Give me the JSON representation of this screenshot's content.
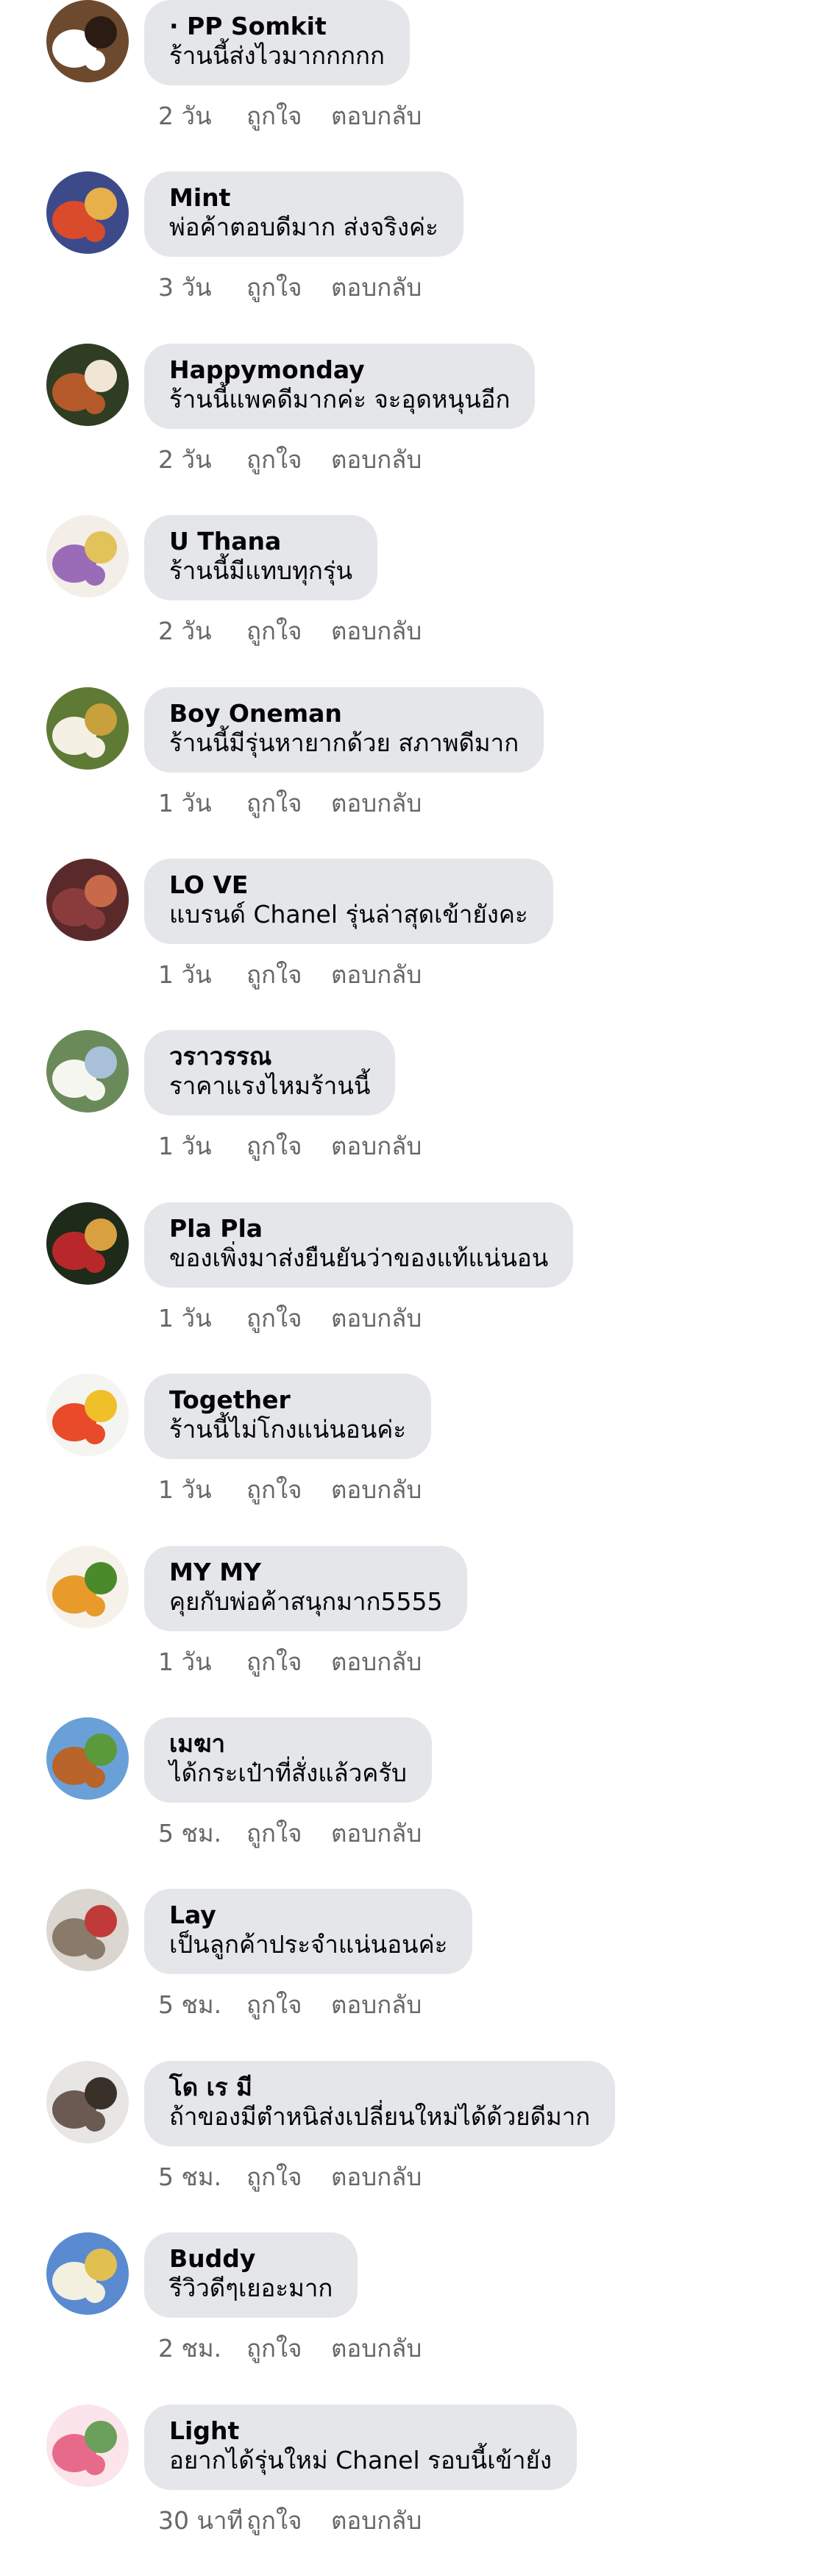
{
  "comments": [
    {
      "author": "· PP Somkit",
      "text": "ร้านนี้ส่งไวมากกกกก",
      "time": "2 วัน",
      "like": "ถูกใจ",
      "reply": "ตอบกลับ",
      "avatar_icon": "beagle-dog-avatar",
      "colors": [
        "#6d4a2e",
        "#ffffff",
        "#2a1c12"
      ]
    },
    {
      "author": "Mint",
      "text": "พ่อค้าตอบดีมาก ส่งจริงค่ะ",
      "time": "3 วัน",
      "like": "ถูกใจ",
      "reply": "ตอบกลับ",
      "avatar_icon": "fruit-bowl-avatar",
      "colors": [
        "#3d4a8a",
        "#d94b2b",
        "#e8b04a"
      ]
    },
    {
      "author": "Happymonday",
      "text": "ร้านนี้แพคดีมากค่ะ จะอุดหนุนอีก",
      "time": "2 วัน",
      "like": "ถูกใจ",
      "reply": "ตอบกลับ",
      "avatar_icon": "red-panda-avatar",
      "colors": [
        "#2f3d22",
        "#b45a2a",
        "#f1e6d6"
      ]
    },
    {
      "author": "U Thana",
      "text": "ร้านนี้มีแทบทุกรุ่น",
      "time": "2 วัน",
      "like": "ถูกใจ",
      "reply": "ตอบกลับ",
      "avatar_icon": "flower-bouquet-avatar",
      "colors": [
        "#f3eee8",
        "#9a6cb8",
        "#e2c35a"
      ]
    },
    {
      "author": "Boy Oneman",
      "text": "ร้านนี้มีรุ่นหายากด้วย สภาพดีมาก",
      "time": "1 วัน",
      "like": "ถูกใจ",
      "reply": "ตอบกลับ",
      "avatar_icon": "bee-flower-avatar",
      "colors": [
        "#5e7a34",
        "#f4f0e4",
        "#c8a03c"
      ]
    },
    {
      "author": "LO VE",
      "text": "แบรนด์ Chanel รุ่นล่าสุดเข้ายังคะ",
      "time": "1 วัน",
      "like": "ถูกใจ",
      "reply": "ตอบกลับ",
      "avatar_icon": "figs-avatar",
      "colors": [
        "#5a2a2a",
        "#8a3c3c",
        "#c86a4a"
      ]
    },
    {
      "author": "วราวรรณ",
      "text": "ราคาแรงไหมร้านนี้",
      "time": "1 วัน",
      "like": "ถูกใจ",
      "reply": "ตอบกลับ",
      "avatar_icon": "white-blossom-avatar",
      "colors": [
        "#6a8a5a",
        "#f6f6f0",
        "#a8c0d8"
      ]
    },
    {
      "author": "Pla Pla",
      "text": "ของเพิ่งมาส่งยืนยันว่าของแท้แน่นอน",
      "time": "1 วัน",
      "like": "ถูกใจ",
      "reply": "ตอบกลับ",
      "avatar_icon": "drinks-avatar",
      "colors": [
        "#1e2a1a",
        "#b8282a",
        "#d8a040"
      ]
    },
    {
      "author": "Together",
      "text": "ร้านนี้ไม่โกงแน่นอนค่ะ",
      "time": "1 วัน",
      "like": "ถูกใจ",
      "reply": "ตอบกลับ",
      "avatar_icon": "fruit-basket-avatar",
      "colors": [
        "#f4f4f0",
        "#e84a2a",
        "#f0c02a"
      ]
    },
    {
      "author": "MY MY",
      "text": "คุยกับพ่อค้าสนุกมาก5555",
      "time": "1 วัน",
      "like": "ถูกใจ",
      "reply": "ตอบกลับ",
      "avatar_icon": "pineapple-fruits-avatar",
      "colors": [
        "#f6f2ea",
        "#e89a2a",
        "#4a8a2a"
      ]
    },
    {
      "author": "เมฆา",
      "text": "ได้กระเป๋าที่สั่งแล้วครับ",
      "time": "5 ชม.",
      "like": "ถูกใจ",
      "reply": "ตอบกลับ",
      "avatar_icon": "calf-avatar",
      "colors": [
        "#6aa0d8",
        "#b8642a",
        "#5a9a3a"
      ]
    },
    {
      "author": "Lay",
      "text": "เป็นลูกค้าประจำแน่นอนค่ะ",
      "time": "5 ชม.",
      "like": "ถูกใจ",
      "reply": "ตอบกลับ",
      "avatar_icon": "kitten-avatar",
      "colors": [
        "#dcd6d0",
        "#8a7a6a",
        "#c03a3a"
      ]
    },
    {
      "author": "โด เร มี",
      "text": "ถ้าของมีตำหนิส่งเปลี่ยนใหม่ได้ด้วยดีมาก",
      "time": "5 ชม.",
      "like": "ถูกใจ",
      "reply": "ตอบกลับ",
      "avatar_icon": "mountain-landscape-avatar",
      "colors": [
        "#e8e6e4",
        "#6a5a52",
        "#3a302a"
      ]
    },
    {
      "author": "Buddy",
      "text": "รีวิวดีๆเยอะมาก",
      "time": "2 ชม.",
      "like": "ถูกใจ",
      "reply": "ตอบกลับ",
      "avatar_icon": "flowers-sky-avatar",
      "colors": [
        "#5a8ad0",
        "#f4f0e0",
        "#e0c050"
      ]
    },
    {
      "author": "Light",
      "text": "อยากได้รุ่นใหม่ Chanel รอบนี้เข้ายัง",
      "time": "30 นาที",
      "like": "ถูกใจ",
      "reply": "ตอบกลับ",
      "avatar_icon": "pink-tulips-avatar",
      "colors": [
        "#fbe4ea",
        "#e86a8a",
        "#6aa05a"
      ]
    }
  ]
}
